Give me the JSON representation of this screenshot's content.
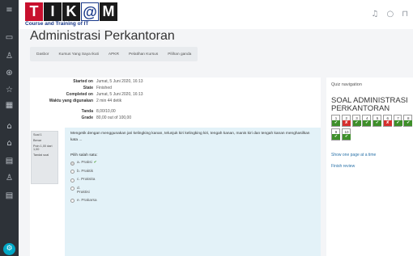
{
  "sidebar": {
    "icons": [
      "menu-icon",
      "dashboard-icon",
      "participants-icon",
      "badges-icon",
      "competencies-icon",
      "grades-icon",
      "site-home-icon",
      "calendar-icon",
      "files-icon",
      "course-icon",
      "user-icon"
    ],
    "glyphs": [
      "≡",
      "▭",
      "♙",
      "⊛",
      "☆",
      "▦",
      "⌂",
      "⌂",
      "▤",
      "♙",
      "▤"
    ],
    "bottom_glyph": "⚙"
  },
  "header": {
    "logo_letters": [
      "T",
      "I",
      "K",
      "@",
      "M"
    ],
    "logo_tagline": "Course and Training of IT",
    "bell_glyph": "♫",
    "chat_glyph": "○",
    "user_glyph": "⊓"
  },
  "page": {
    "title": "Administrasi Perkantoran",
    "breadcrumbs": [
      "Dasbor",
      "Kursus Yang Saya Ikuti",
      "APKR",
      "Pelatihan Kursus",
      "Pilihan ganda"
    ]
  },
  "summary": [
    {
      "label": "Started on",
      "value": "Jumat, 5 Juni 2020, 16:13"
    },
    {
      "label": "State",
      "value": "Finished"
    },
    {
      "label": "Completed on",
      "value": "Jumat, 5 Juni 2020, 16:13"
    },
    {
      "label": "Waktu yang digunakan",
      "value": "2 min 44 detik"
    },
    {
      "label": "Tanda",
      "value": "8,00/10,00"
    },
    {
      "label": "Grade",
      "value": "80,00 out of 100,00"
    }
  ],
  "question_info": {
    "number": "Soal 1",
    "status": "Benar",
    "mark": "Poin 1,00 dari 1,00",
    "flag": "Tandai soal"
  },
  "question": {
    "text": "Mengetik dengan menggunakan jari kelingking kanan, telunjuk kiri kelingking kiri, tengah kanan, manis kiri dan tengah kanan menghasilkan kata ...",
    "prompt": "Pilih salah satu:",
    "options": [
      {
        "label": "a. Praksi",
        "selected": true,
        "correct": true
      },
      {
        "label": "b. Praktik",
        "selected": false,
        "correct": false
      },
      {
        "label": "c. Praksita",
        "selected": false,
        "correct": false
      },
      {
        "label": "d. Praktisi",
        "selected": false,
        "correct": false
      },
      {
        "label": "e. Prakarsa",
        "selected": false,
        "correct": false
      }
    ],
    "tick_glyph": "✔"
  },
  "quiz_nav": {
    "title": "Quiz navigation",
    "quiz_name": "SOAL ADMINISTRASI PERKANTORAN",
    "questions": [
      {
        "num": "1",
        "correct": true
      },
      {
        "num": "2",
        "correct": false
      },
      {
        "num": "3",
        "correct": true
      },
      {
        "num": "4",
        "correct": true
      },
      {
        "num": "5",
        "correct": true
      },
      {
        "num": "6",
        "correct": false
      },
      {
        "num": "7",
        "correct": true
      },
      {
        "num": "8",
        "correct": true
      },
      {
        "num": "9",
        "correct": true
      },
      {
        "num": "10",
        "correct": true
      }
    ],
    "ok_glyph": "✔",
    "bad_glyph": "✘",
    "show_one_page": "Show one page at a time",
    "finish_review": "Finish review"
  }
}
